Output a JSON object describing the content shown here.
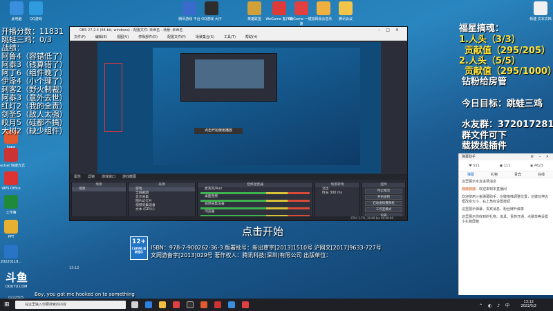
{
  "desktop": {
    "icons_top": [
      {
        "label": "此电脑",
        "color": "#3a8ede"
      },
      {
        "label": "QQ游戏",
        "color": "#2e9bde"
      },
      {
        "label": "腾讯游戏 平台",
        "color": "#3a6acc"
      },
      {
        "label": "QQ游戏 大厅",
        "color": "#2d2d2d"
      },
      {
        "label": "英雄联盟",
        "color": "#d0a03a"
      },
      {
        "label": "WeGame 客户端",
        "color": "#dd3a3a"
      },
      {
        "label": "WeGame 一键加速",
        "color": "#e04040"
      },
      {
        "label": "网易云音乐",
        "color": "#f0b040"
      },
      {
        "label": "腾讯会议",
        "color": "#f2c44a"
      },
      {
        "label": "新建 文本文档",
        "color": "#f0f0f0"
      }
    ],
    "icons_left": [
      {
        "label": "kapa",
        "color": "#e25a2f"
      },
      {
        "label": "wechat 快捷方式",
        "color": "#c33"
      },
      {
        "label": "WPS Office",
        "color": "#d33"
      },
      {
        "label": "工作簿",
        "color": "#1e8a3a"
      },
      {
        "label": "PPT",
        "color": "#e8b030"
      },
      {
        "label": "20220119...",
        "color": "#2a74c8"
      }
    ]
  },
  "overlay_left": {
    "score": "开播分数：11831",
    "jump": "跳蛙三鸡：0/3",
    "record_label": "战绩：",
    "lines": [
      "阿鲁4（容错低了）",
      "阿泰3（钱算错了）",
      "阿丁6（组件晚了）",
      "伊泽4（小个理了）",
      "刺客2（野火制裁）",
      "阿泰3（意外去世）",
      "红灯2（我的全责）",
      "剑圣5（敌人太强）",
      "皎月5（硅都不搞）",
      "大树2（缺少组件）"
    ]
  },
  "overlay_right": {
    "title": "福星搞魂：",
    "items": [
      "1.人头（3/3）",
      "贡献值（295/205）",
      "2.人头（5/5）",
      "贡献值（295/1000）",
      "钻粉给房管"
    ],
    "target": "今日目标：跳蛙三鸡",
    "group": "水友群：372017281",
    "file": "群文件可下",
    "plugin": "载拨线插件"
  },
  "obs": {
    "title": "OBS 27.2.4 (64-bit, windows) - 配置文件: 未命名 - 场景: 未命名",
    "menu": [
      "文件(F)",
      "编辑(E)",
      "视图(V)",
      "停靠部件(D)",
      "配置文件(P)",
      "场景集合(S)",
      "工具(T)",
      "帮助(H)"
    ],
    "preview_button": "点击开始使用播放",
    "toolbar": [
      "属性",
      "滤镜",
      "游戏窗口",
      "游戏截图"
    ],
    "scenes_header": "场景",
    "scenes": [
      "场景"
    ],
    "sources_header": "来源",
    "sources": [
      "游戏",
      "全屏截图",
      "显示采集",
      "图片幻灯片",
      "视频采集设备",
      "文本 (GDI+)"
    ],
    "mixer_header": "音频混音器",
    "mixer": [
      "麦克风/Aux",
      "桌面音频",
      "视频采集设备",
      "浏览器"
    ],
    "transitions_header": "场景转场",
    "transition_type": "淡出",
    "duration_label": "时长",
    "duration_value": "300 ms",
    "controls_header": "控件",
    "controls": [
      "停止推流",
      "开始录制",
      "启动虚拟摄像机",
      "工作室模式",
      "设置",
      "退出"
    ],
    "status": "CPU: 1.7%, 30.00 fps",
    "time": "00:00:00"
  },
  "subtitle_start": "点击开始",
  "age_badge": {
    "main": "12+",
    "sub": "CADPA 适龄提示"
  },
  "isbn_line1": "ISBN：978-7-900262-36-3 版署批号：新出审字[2013]1510号 沪网文[2017]9633-727号",
  "isbn_line2": "文网游备字[2013]029号 著作权人：腾讯科技(深圳)有限公司 出版单位：",
  "douyu": {
    "main": "斗鱼",
    "sub": "DOUYU.COM"
  },
  "overlay_clock": "13:12",
  "subtitle_en": "Boy, you got me hooked on to something",
  "credit": "0222505",
  "chat": {
    "title": "弹幕助手",
    "stats": [
      "521",
      "111",
      "4623"
    ],
    "tabs": [
      "弹幕",
      "礼物",
      "贵宾",
      "在线"
    ],
    "messages": [
      {
        "name": "",
        "text": "这里展示水友进场消息"
      },
      {
        "name": "鹿鹿鹿鹿：",
        "text": "欢迎来到本直播间"
      },
      {
        "name": "",
        "text": "欢迎使用斗鱼弹幕助手：左键拖拽调整位置，左键拉伸边框改变大小，右上角有设置按钮"
      },
      {
        "name": "",
        "text": "这里展示弹幕、贵宾消息、粉丝牌升级等"
      },
      {
        "name": "",
        "text": "这里展示你收到的礼物、道具、贵族开通、点歌单等设置小礼物屏蔽"
      }
    ]
  },
  "taskbar": {
    "search_placeholder": "在这里输入你要搜索的内容",
    "time": "13:12",
    "date": "2022/5/2"
  }
}
